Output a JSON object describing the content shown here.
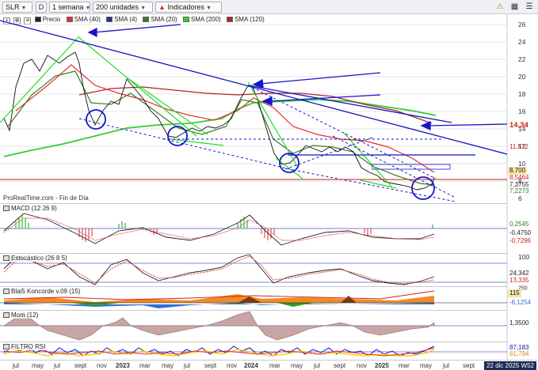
{
  "toolbar": {
    "symbol": "SLR",
    "d_label": "D",
    "period": "1 semana",
    "units": "200 unidades",
    "indicators": "Indicadores"
  },
  "legend": {
    "price": "Precio",
    "sma40": "SMA (40)",
    "sma4": "SMA (4)",
    "sma20": "SMA (20)",
    "sma200": "SMA (200)",
    "sma120": "SMA (120)"
  },
  "colors": {
    "sma40": "#e53030",
    "sma4": "#2b2b8c",
    "sma20": "#3b7a2a",
    "sma200": "#33cc33",
    "sma120": "#b22222",
    "trend": "#1515c8"
  },
  "watermark": "ProRealTime.com - Fin de Día",
  "price_axis": {
    "ticks": [
      "26",
      "24",
      "22",
      "20",
      "18",
      "16",
      "14",
      "12",
      "10",
      "8",
      "6"
    ],
    "tags": [
      {
        "text": "14,34",
        "bg": "#ffffff",
        "fg": "#d02020"
      },
      {
        "text": "11,872",
        "bg": "#ffffff",
        "fg": "#c02020"
      },
      {
        "text": "8,700",
        "bg": "#f6e7a8",
        "fg": "#111111"
      },
      {
        "text": "8,5464",
        "bg": "#ffffff",
        "fg": "#d02020"
      },
      {
        "text": "7,3755",
        "bg": "#ffffff",
        "fg": "#222222"
      },
      {
        "text": "7,2273",
        "bg": "#ffffff",
        "fg": "#2a7a2a"
      }
    ]
  },
  "panels": {
    "macd": {
      "label": "MACD (12 26 9)",
      "values": [
        "0,2545",
        "-0,4750",
        "-0,7296"
      ]
    },
    "stoch": {
      "label": "Estocástico (26 8 5)",
      "ticks": [
        "100"
      ],
      "values": [
        "24,342",
        "13,335"
      ]
    },
    "blai": {
      "label": "Blai5 Koncorde v.09 (15)",
      "values": [
        "115",
        "-6,1254"
      ],
      "ticks": [
        "250"
      ]
    },
    "mom": {
      "label": "Mom (12)",
      "values": [
        "1,3500"
      ]
    },
    "filtro": {
      "label": "FILTRO RSI",
      "values": [
        "87,183",
        "61,794"
      ]
    }
  },
  "x_axis": {
    "labels": [
      "jul",
      "may",
      "jul",
      "sept",
      "nov",
      "2023",
      "mar",
      "may",
      "jul",
      "sept",
      "nov",
      "2024",
      "mar",
      "may",
      "jul",
      "sept",
      "nov",
      "2025",
      "mar",
      "may",
      "jul",
      "sept"
    ],
    "date_badge": "22 dic 2025 W52"
  }
}
